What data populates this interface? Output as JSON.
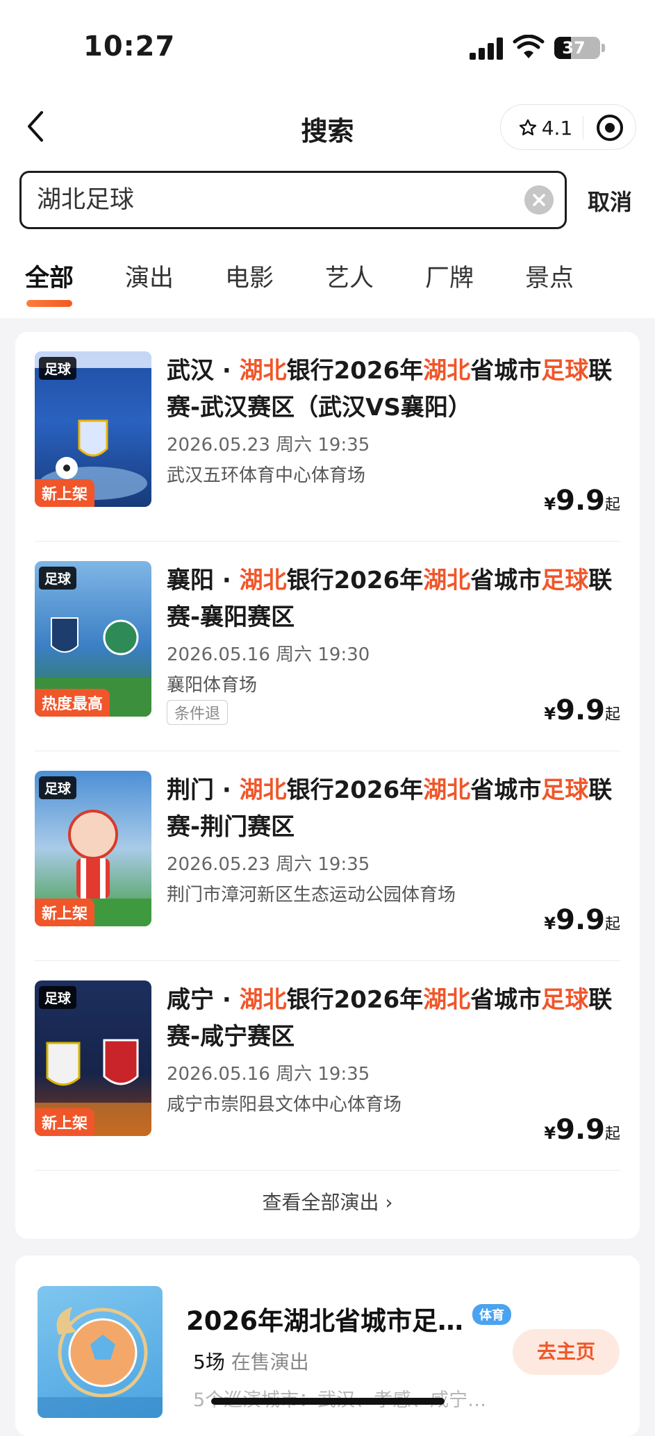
{
  "status_bar": {
    "time": "10:27",
    "battery": "37",
    "battery_level_pct": 37
  },
  "nav": {
    "title": "搜索",
    "rating": "4.1"
  },
  "search": {
    "value": "湖北足球",
    "cancel_label": "取消"
  },
  "tabs": [
    {
      "label": "全部",
      "active": true
    },
    {
      "label": "演出"
    },
    {
      "label": "电影"
    },
    {
      "label": "艺人"
    },
    {
      "label": "厂牌"
    },
    {
      "label": "景点"
    }
  ],
  "results": [
    {
      "poster_tag": "足球",
      "badge": "新上架",
      "title_parts": [
        {
          "text": "武汉 · ",
          "hl": false
        },
        {
          "text": "湖北",
          "hl": true
        },
        {
          "text": "银行2026年",
          "hl": false
        },
        {
          "text": "湖北",
          "hl": true
        },
        {
          "text": "省城市",
          "hl": false
        },
        {
          "text": "足球",
          "hl": true
        },
        {
          "text": "联赛-武汉赛区（武汉VS襄阳）",
          "hl": false
        }
      ],
      "date": "2026.05.23 周六 19:35",
      "venue": "武汉五环体育中心体育场",
      "tag": "",
      "price": {
        "currency": "¥",
        "value": "9.9",
        "suffix": "起"
      }
    },
    {
      "poster_tag": "足球",
      "badge": "热度最高",
      "title_parts": [
        {
          "text": "襄阳 · ",
          "hl": false
        },
        {
          "text": "湖北",
          "hl": true
        },
        {
          "text": "银行2026年",
          "hl": false
        },
        {
          "text": "湖北",
          "hl": true
        },
        {
          "text": "省城市",
          "hl": false
        },
        {
          "text": "足球",
          "hl": true
        },
        {
          "text": "联赛-襄阳赛区",
          "hl": false
        }
      ],
      "date": "2026.05.16 周六 19:30",
      "venue": "襄阳体育场",
      "tag": "条件退",
      "price": {
        "currency": "¥",
        "value": "9.9",
        "suffix": "起"
      }
    },
    {
      "poster_tag": "足球",
      "badge": "新上架",
      "title_parts": [
        {
          "text": "荆门 · ",
          "hl": false
        },
        {
          "text": "湖北",
          "hl": true
        },
        {
          "text": "银行2026年",
          "hl": false
        },
        {
          "text": "湖北",
          "hl": true
        },
        {
          "text": "省城市",
          "hl": false
        },
        {
          "text": "足球",
          "hl": true
        },
        {
          "text": "联赛-荆门赛区",
          "hl": false
        }
      ],
      "date": "2026.05.23 周六 19:35",
      "venue": "荆门市漳河新区生态运动公园体育场",
      "tag": "",
      "price": {
        "currency": "¥",
        "value": "9.9",
        "suffix": "起"
      }
    },
    {
      "poster_tag": "足球",
      "badge": "新上架",
      "title_parts": [
        {
          "text": "咸宁 · ",
          "hl": false
        },
        {
          "text": "湖北",
          "hl": true
        },
        {
          "text": "银行2026年",
          "hl": false
        },
        {
          "text": "湖北",
          "hl": true
        },
        {
          "text": "省城市",
          "hl": false
        },
        {
          "text": "足球",
          "hl": true
        },
        {
          "text": "联赛-咸宁赛区",
          "hl": false
        }
      ],
      "date": "2026.05.16 周六 19:35",
      "venue": "咸宁市崇阳县文体中心体育场",
      "tag": "",
      "price": {
        "currency": "¥",
        "value": "9.9",
        "suffix": "起"
      }
    }
  ],
  "view_all_label": "查看全部演出 ›",
  "artist": {
    "name": "2026年湖北省城市足…",
    "badge": "体育",
    "show_count": "5场",
    "show_count_label": "在售演出",
    "cities": "5个巡演城市：武汉、孝感、咸宁…",
    "home_button": "去主页"
  },
  "colors": {
    "accent": "#f0562a",
    "highlight": "#f0562a",
    "sport_badge": "#4aa3ef"
  }
}
